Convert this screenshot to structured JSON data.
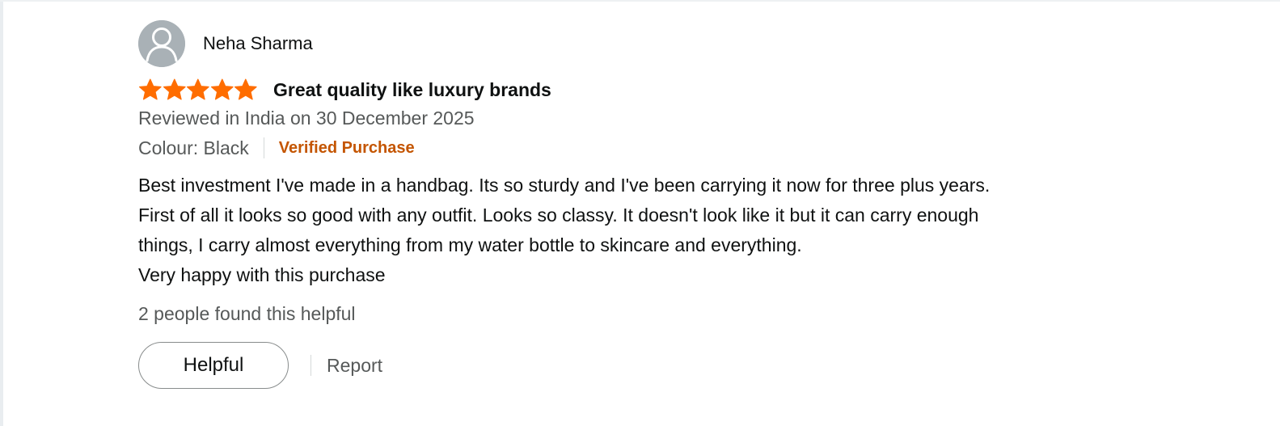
{
  "review": {
    "reviewer_name": "Neha Sharma",
    "rating": 5,
    "max_rating": 5,
    "title": "Great quality like luxury brands",
    "date_text": "Reviewed in India on 30 December 2025",
    "variant_text": "Colour: Black",
    "verified_text": "Verified Purchase",
    "body_lines": [
      "Best investment I've made in a handbag. Its so sturdy and I've been carrying it now for three plus years.",
      "First of all it looks so good with any outfit. Looks so classy. It doesn't look like it but it can carry enough",
      "things, I carry almost everything from my water bottle to skincare and everything.",
      "Very happy with this purchase"
    ],
    "helpful_count_text": "2 people found this helpful",
    "helpful_button_label": "Helpful",
    "report_label": "Report"
  },
  "icons": {
    "avatar": "user-avatar-icon",
    "star": "star-icon"
  },
  "colors": {
    "star": "#ff6d00",
    "verified": "#c45500",
    "secondary_text": "#565959",
    "primary_text": "#0f1111",
    "avatar": "#a9b1b6"
  }
}
